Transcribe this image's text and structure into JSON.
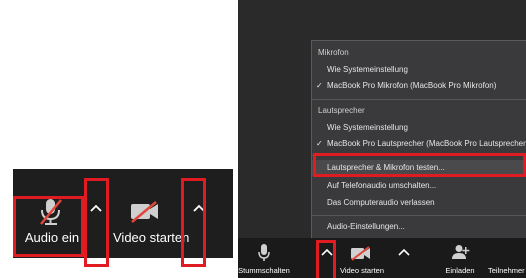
{
  "left_toolbar": {
    "audio_label": "Audio ein",
    "video_label": "Video starten",
    "chevron": "^"
  },
  "menu": {
    "microphone_header": "Mikrofon",
    "mic_items": [
      {
        "label": "Wie Systemeinstellung",
        "checked": false
      },
      {
        "label": "MacBook Pro Mikrofon (MacBook Pro Mikrofon)",
        "checked": true
      }
    ],
    "speaker_header": "Lautsprecher",
    "speaker_items": [
      {
        "label": "Wie Systemeinstellung",
        "checked": false
      },
      {
        "label": "MacBook Pro Lautsprecher (MacBook Pro Lautsprecher)",
        "checked": true
      }
    ],
    "actions": [
      {
        "label": "Lautsprecher & Mikrofon testen...",
        "highlighted": true
      },
      {
        "label": "Auf Telefonaudio umschalten...",
        "highlighted": false
      },
      {
        "label": "Das Computeraudio verlassen",
        "highlighted": false
      }
    ],
    "settings_label": "Audio-Einstellungen...",
    "check_glyph": "✓"
  },
  "right_toolbar": {
    "mute_label": "Stummschalten",
    "video_label": "Video starten",
    "invite_label": "Einladen",
    "participants_label": "Teilnehmer",
    "chevron": "^"
  },
  "colors": {
    "highlight_border": "#e11b22",
    "toolbar_bg": "#1e1e1e",
    "menu_bg": "#3a3a3c",
    "mute_red": "#e0463a"
  }
}
